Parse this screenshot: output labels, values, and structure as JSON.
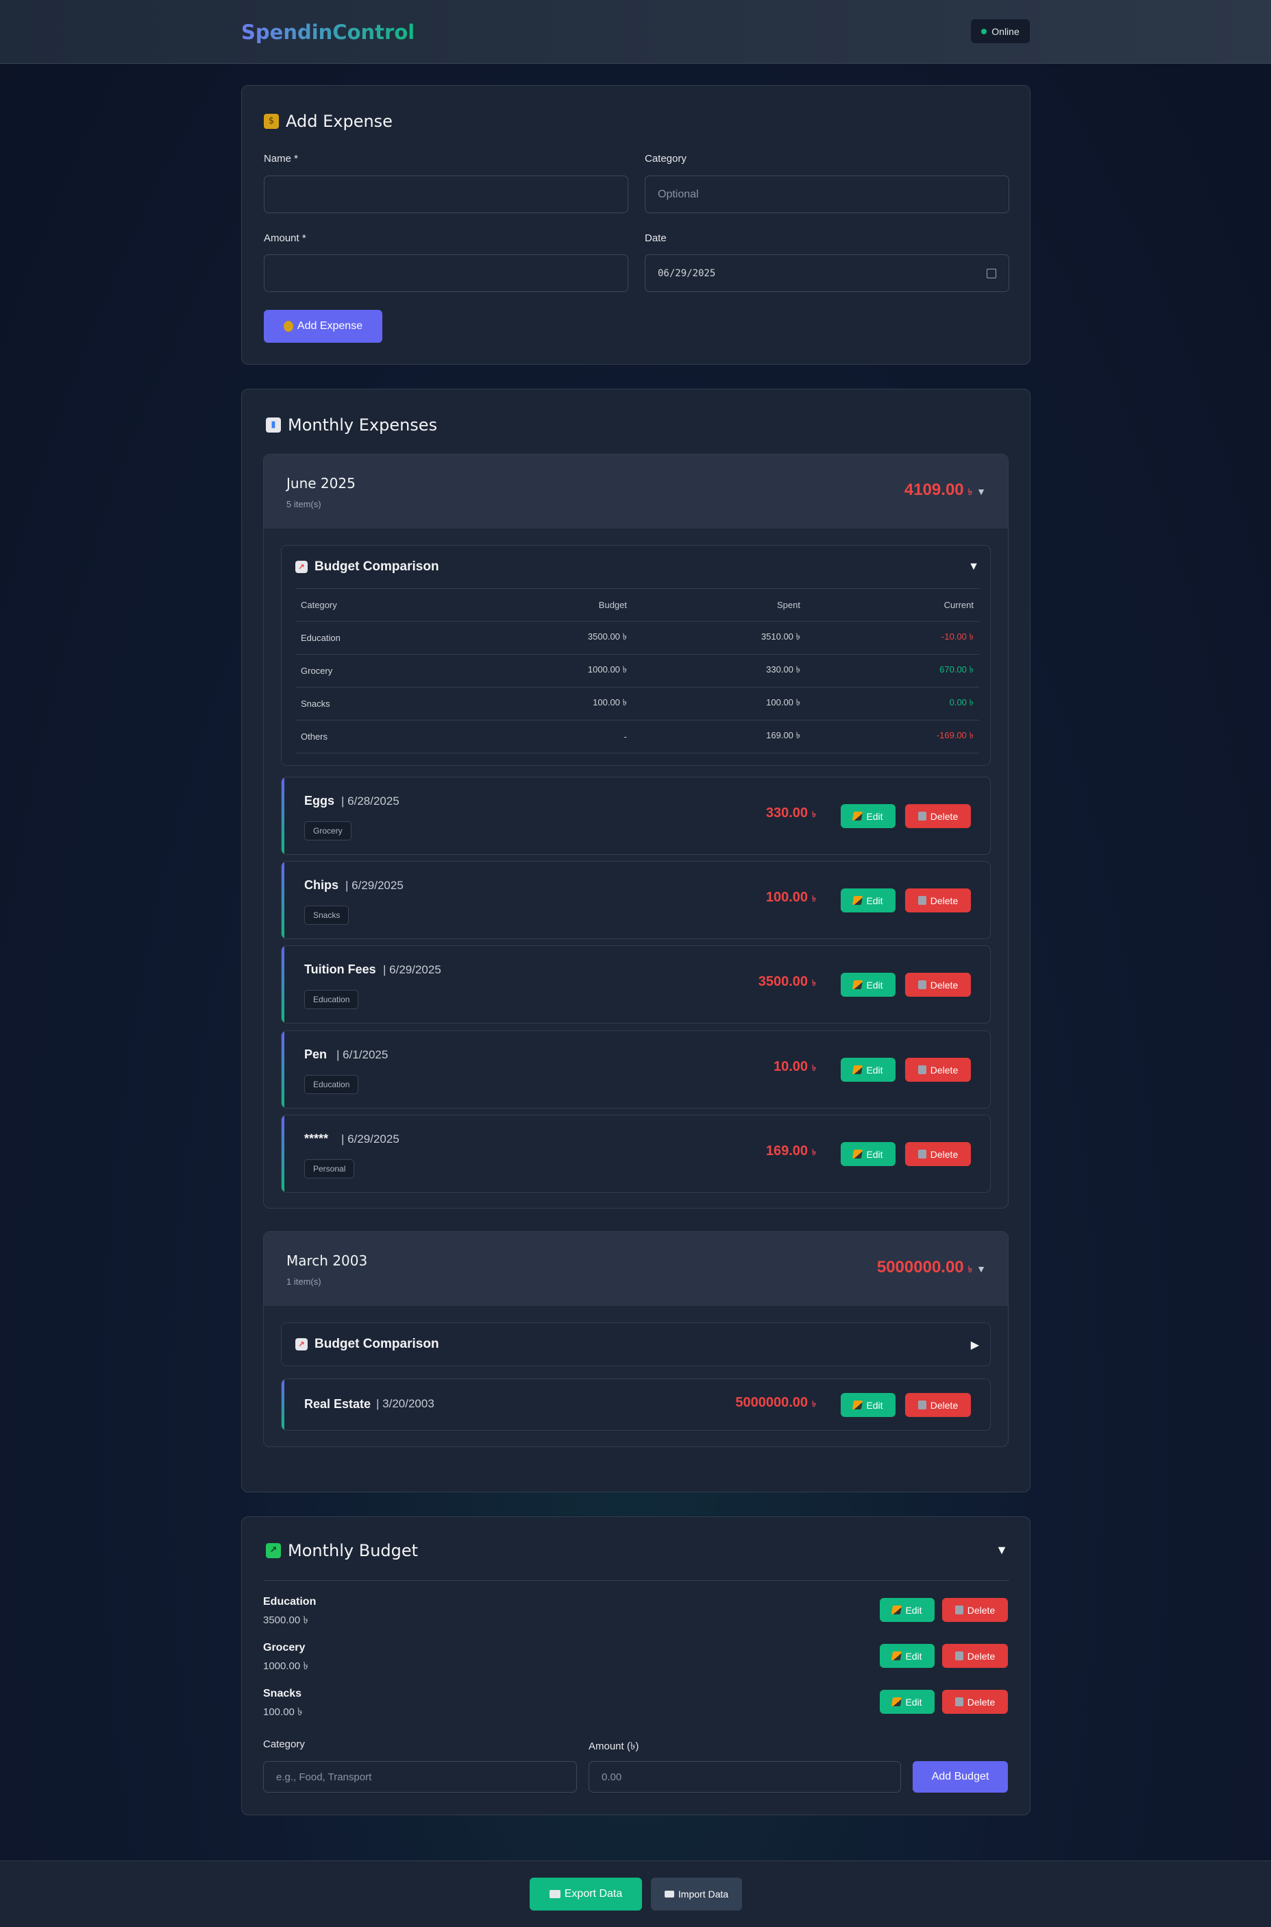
{
  "app": {
    "title": "SpendinControl",
    "status": "Online"
  },
  "add_expense": {
    "title": "Add Expense",
    "name_label": "Name *",
    "category_label": "Category",
    "category_placeholder": "Optional",
    "amount_label": "Amount *",
    "date_label": "Date",
    "date_value": "06/29/2025",
    "button": "Add Expense"
  },
  "monthly_expenses": {
    "title": "Monthly Expenses",
    "months": [
      {
        "name": "June 2025",
        "count": "5 item(s)",
        "total": "4109.00",
        "currency": "৳",
        "budget_title": "Budget Comparison",
        "table_headers": [
          "Category",
          "Budget",
          "Spent",
          "Current"
        ],
        "table_rows": [
          {
            "category": "Education",
            "budget": "3500.00 ৳",
            "spent": "3510.00 ৳",
            "current": "-10.00 ৳"
          },
          {
            "category": "Grocery",
            "budget": "1000.00 ৳",
            "spent": "330.00 ৳",
            "current": "670.00 ৳"
          },
          {
            "category": "Snacks",
            "budget": "100.00 ৳",
            "spent": "100.00 ৳",
            "current": "0.00 ৳"
          },
          {
            "category": "Others",
            "budget": "-",
            "spent": "169.00 ৳",
            "current": "-169.00 ৳"
          }
        ],
        "items": [
          {
            "name": "Eggs",
            "date": "| 6/28/2025",
            "tag": "Grocery",
            "amount": "330.00"
          },
          {
            "name": "Chips",
            "date": "| 6/29/2025",
            "tag": "Snacks",
            "amount": "100.00"
          },
          {
            "name": "Tuition Fees",
            "date": "| 6/29/2025",
            "tag": "Education",
            "amount": "3500.00"
          },
          {
            "name": "Pen",
            "date": "| 6/1/2025",
            "tag": "Education",
            "amount": "10.00"
          },
          {
            "name": "*****",
            "date": "| 6/29/2025",
            "tag": "Personal",
            "amount": "169.00"
          }
        ]
      },
      {
        "name": "March 2003",
        "count": "1 item(s)",
        "total": "5000000.00",
        "currency": "৳",
        "budget_title": "Budget Comparison",
        "items": [
          {
            "name": "Real Estate",
            "date": "| 3/20/2003",
            "amount": "5000000.00"
          }
        ]
      }
    ]
  },
  "buttons": {
    "edit": "Edit",
    "delete": "Delete"
  },
  "monthly_budget": {
    "title": "Monthly Budget",
    "items": [
      {
        "category": "Education",
        "amount": "3500.00 ৳"
      },
      {
        "category": "Grocery",
        "amount": "1000.00 ৳"
      },
      {
        "category": "Snacks",
        "amount": "100.00 ৳"
      }
    ],
    "category_label": "Category",
    "category_placeholder": "e.g., Food, Transport",
    "amount_label": "Amount (৳)",
    "amount_placeholder": "0.00",
    "button": "Add Budget"
  },
  "footer": {
    "export": "Export Data",
    "import": "Import Data"
  },
  "colors": {
    "accent": "#6366f1",
    "success": "#10b981",
    "danger": "#ef4444",
    "background": "#0f1a30"
  }
}
